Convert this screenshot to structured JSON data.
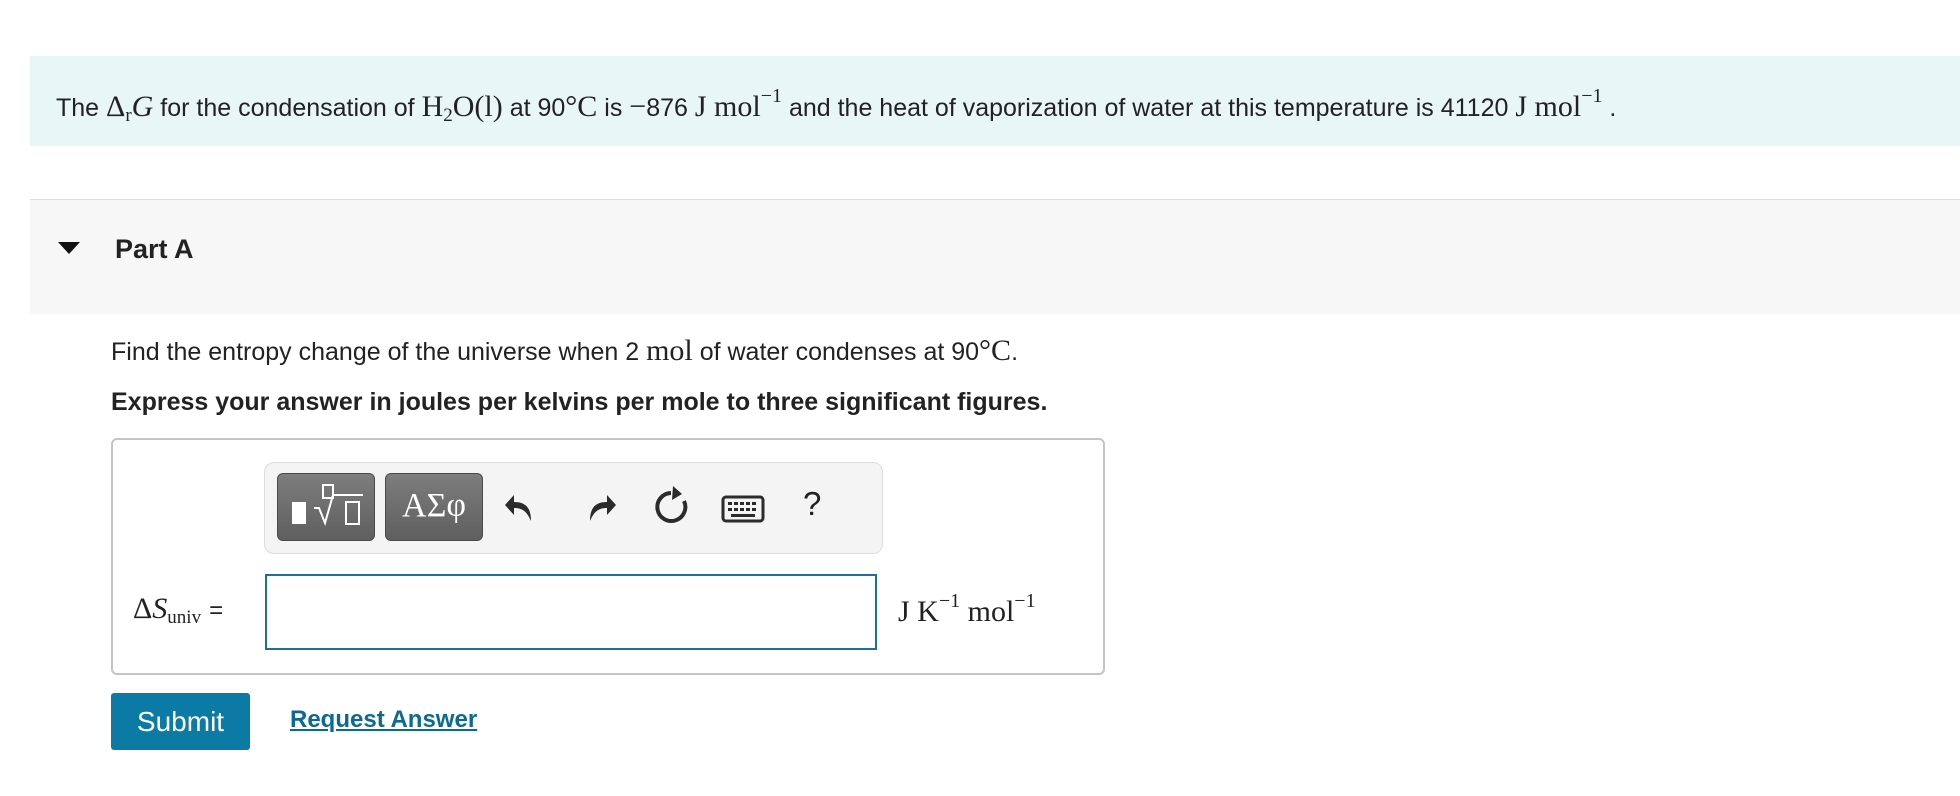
{
  "problem": {
    "t1": "The ",
    "m_delta": "Δ",
    "m_r": "r",
    "m_G": "G",
    "t2": " for the condensation of ",
    "m_H": "H",
    "m_2": "2",
    "m_O": "O(l)",
    "t3": " at 90",
    "m_deg": "°C",
    "t4": " is ",
    "m_neg": "−",
    "t5": "876 ",
    "m_unit1": "J mol",
    "m_exp1": "−1",
    "t6": " and the heat of vaporization of water at this temperature is 41120 ",
    "m_unit2": "J mol",
    "m_exp2": "−1",
    "t7": " ."
  },
  "part": {
    "title": "Part A"
  },
  "question": {
    "t1": "Find the entropy change of the universe when 2 ",
    "m_mol": "mol",
    "t2": " of water condenses at 90",
    "m_deg": "°C",
    "t3": "."
  },
  "instruction": "Express your answer in joules per kelvins per mole to three significant figures.",
  "toolbar": {
    "greek_label": "ΑΣφ",
    "help_label": "?"
  },
  "answer": {
    "lhs_delta": "Δ",
    "lhs_S": "S",
    "lhs_sub": "univ",
    "lhs_eq": "=",
    "value": "",
    "units_J": "J K",
    "units_exp1": "−1",
    "units_mol": " mol",
    "units_exp2": "−1"
  },
  "buttons": {
    "submit": "Submit",
    "request": "Request Answer"
  },
  "colors": {
    "problem_bg": "#e8f6f6",
    "accent": "#0b7ba6",
    "input_border": "#1f6f9a"
  },
  "icons": {
    "templates": "fraction-radical-templates-icon",
    "undo": "undo-icon",
    "redo": "redo-icon",
    "reset": "reset-icon",
    "keyboard": "keyboard-icon"
  }
}
